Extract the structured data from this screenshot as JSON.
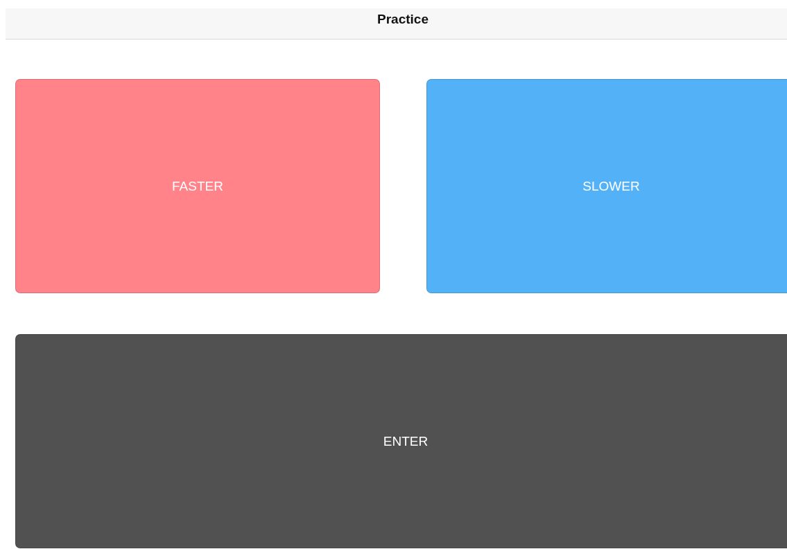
{
  "header": {
    "title": "Practice"
  },
  "buttons": [
    {
      "label": "FASTER",
      "color": "#ff8389"
    },
    {
      "label": "SLOWER",
      "color": "#53b1f8"
    },
    {
      "label": "ENTER",
      "color": "#515151"
    }
  ]
}
